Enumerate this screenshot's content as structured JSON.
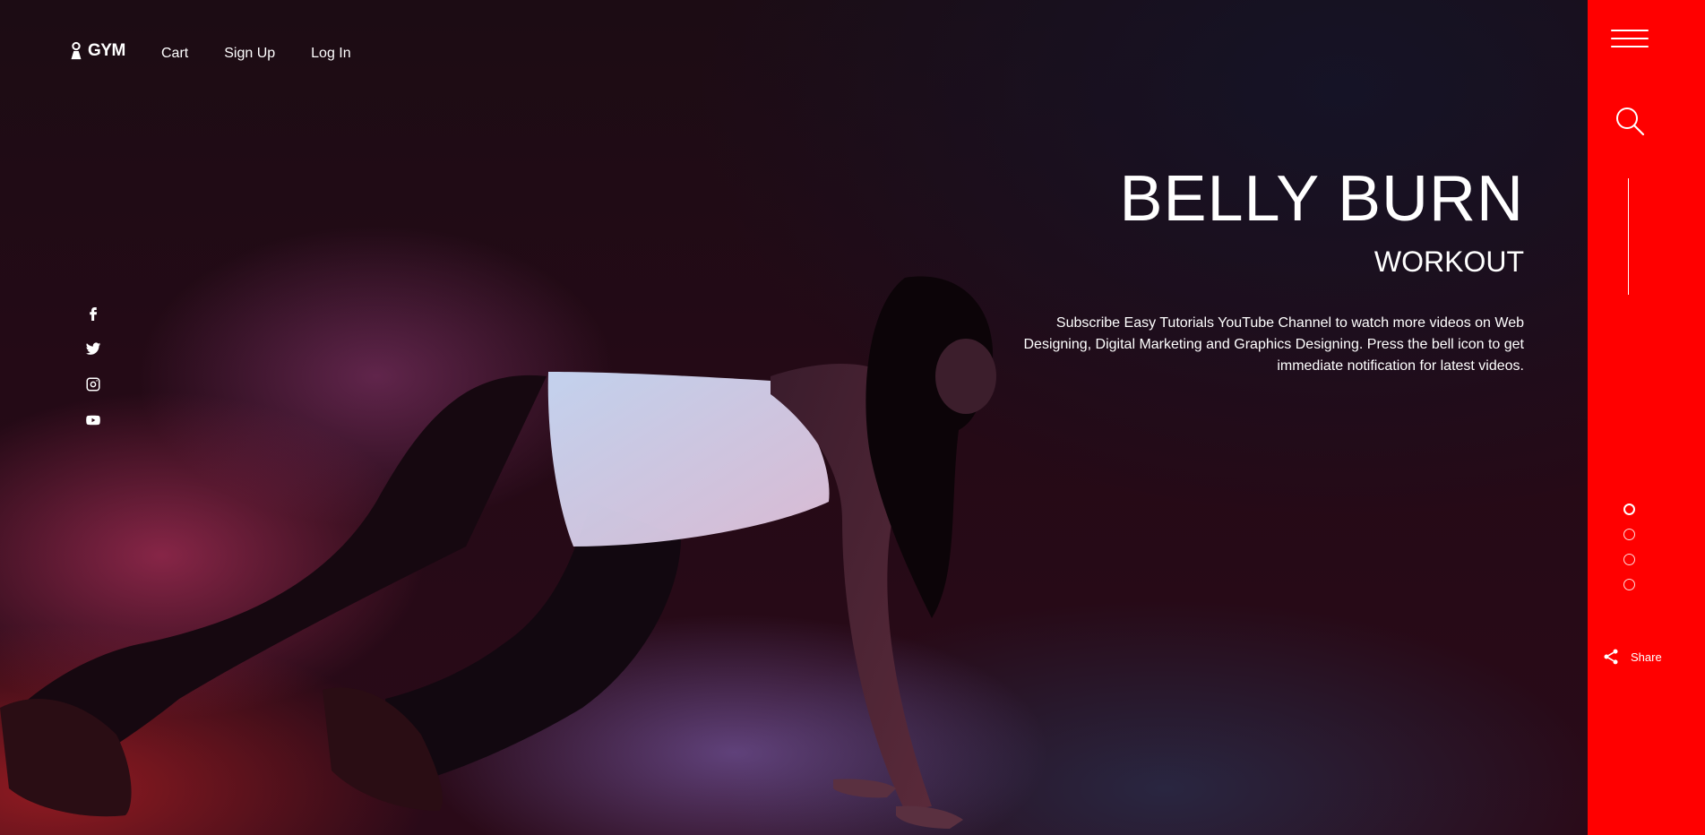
{
  "brand": {
    "logo_text": "GYM"
  },
  "nav": {
    "cart": "Cart",
    "signup": "Sign Up",
    "login": "Log In"
  },
  "hero": {
    "title": "BELLY BURN",
    "subtitle": "WORKOUT",
    "description": "Subscribe Easy Tutorials YouTube Channel to watch more videos on Web Designing, Digital Marketing and Graphics Designing. Press the bell icon to get immediate notification for latest videos."
  },
  "social": [
    "facebook-icon",
    "twitter-icon",
    "instagram-icon",
    "youtube-icon"
  ],
  "sidebar": {
    "share_label": "Share",
    "slide_count": 4,
    "active_slide": 1,
    "accent_color": "#ff0000"
  }
}
